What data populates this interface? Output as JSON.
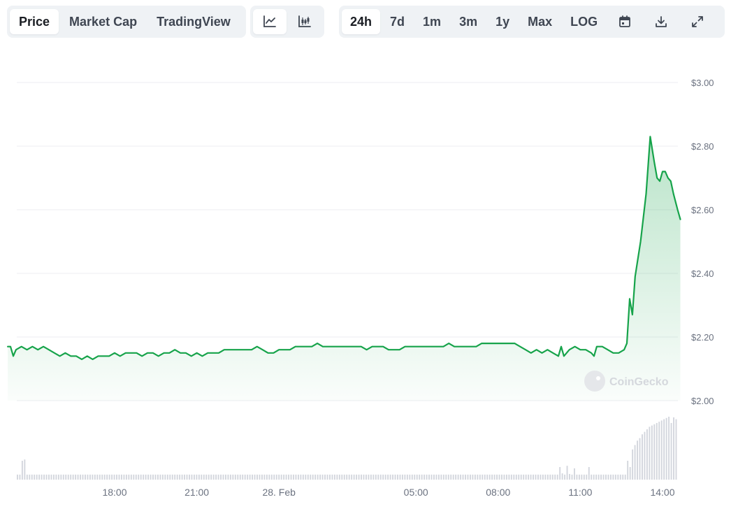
{
  "toolbar": {
    "metric_tabs": [
      {
        "label": "Price",
        "active": true
      },
      {
        "label": "Market Cap",
        "active": false
      },
      {
        "label": "TradingView",
        "active": false
      }
    ],
    "chart_type_buttons": [
      {
        "icon": "line-chart-icon",
        "active": true
      },
      {
        "icon": "candlestick-chart-icon",
        "active": false
      }
    ],
    "range_tabs": [
      {
        "label": "24h",
        "active": true
      },
      {
        "label": "7d",
        "active": false
      },
      {
        "label": "1m",
        "active": false
      },
      {
        "label": "3m",
        "active": false
      },
      {
        "label": "1y",
        "active": false
      },
      {
        "label": "Max",
        "active": false
      },
      {
        "label": "LOG",
        "active": false
      }
    ],
    "action_icons": [
      "calendar-icon",
      "download-icon",
      "expand-icon"
    ]
  },
  "watermark": {
    "text": "CoinGecko"
  },
  "colors": {
    "line": "#16a34a",
    "fill_top": "#16a34a",
    "grid": "#eceef1",
    "volume": "#d3d6dd",
    "axis_text": "#6b7280"
  },
  "chart_data": {
    "type": "line",
    "title": "",
    "xlabel": "",
    "ylabel": "",
    "ylim": [
      2.0,
      3.0
    ],
    "y_ticks": [
      "$3.00",
      "$2.80",
      "$2.60",
      "$2.40",
      "$2.20",
      "$2.00"
    ],
    "x_ticks": [
      {
        "label": "18:00",
        "hour": 18
      },
      {
        "label": "21:00",
        "hour": 21
      },
      {
        "label": "28. Feb",
        "hour": 24
      },
      {
        "label": "05:00",
        "hour": 29
      },
      {
        "label": "08:00",
        "hour": 32
      },
      {
        "label": "11:00",
        "hour": 35
      },
      {
        "label": "14:00",
        "hour": 38
      }
    ],
    "x_range_hours": [
      14.1,
      38.4
    ],
    "series": [
      {
        "values": [
          [
            14.1,
            2.17
          ],
          [
            14.2,
            2.17
          ],
          [
            14.3,
            2.14
          ],
          [
            14.4,
            2.16
          ],
          [
            14.6,
            2.17
          ],
          [
            14.8,
            2.16
          ],
          [
            15.0,
            2.17
          ],
          [
            15.2,
            2.16
          ],
          [
            15.4,
            2.17
          ],
          [
            15.6,
            2.16
          ],
          [
            15.8,
            2.15
          ],
          [
            16.0,
            2.14
          ],
          [
            16.2,
            2.15
          ],
          [
            16.4,
            2.14
          ],
          [
            16.6,
            2.14
          ],
          [
            16.8,
            2.13
          ],
          [
            17.0,
            2.14
          ],
          [
            17.2,
            2.13
          ],
          [
            17.4,
            2.14
          ],
          [
            17.6,
            2.14
          ],
          [
            17.8,
            2.14
          ],
          [
            18.0,
            2.15
          ],
          [
            18.2,
            2.14
          ],
          [
            18.4,
            2.15
          ],
          [
            18.6,
            2.15
          ],
          [
            18.8,
            2.15
          ],
          [
            19.0,
            2.14
          ],
          [
            19.2,
            2.15
          ],
          [
            19.4,
            2.15
          ],
          [
            19.6,
            2.14
          ],
          [
            19.8,
            2.15
          ],
          [
            20.0,
            2.15
          ],
          [
            20.2,
            2.16
          ],
          [
            20.4,
            2.15
          ],
          [
            20.6,
            2.15
          ],
          [
            20.8,
            2.14
          ],
          [
            21.0,
            2.15
          ],
          [
            21.2,
            2.14
          ],
          [
            21.4,
            2.15
          ],
          [
            21.6,
            2.15
          ],
          [
            21.8,
            2.15
          ],
          [
            22.0,
            2.16
          ],
          [
            22.2,
            2.16
          ],
          [
            22.4,
            2.16
          ],
          [
            22.6,
            2.16
          ],
          [
            22.8,
            2.16
          ],
          [
            23.0,
            2.16
          ],
          [
            23.2,
            2.17
          ],
          [
            23.4,
            2.16
          ],
          [
            23.6,
            2.15
          ],
          [
            23.8,
            2.15
          ],
          [
            24.0,
            2.16
          ],
          [
            24.2,
            2.16
          ],
          [
            24.4,
            2.16
          ],
          [
            24.6,
            2.17
          ],
          [
            24.8,
            2.17
          ],
          [
            25.0,
            2.17
          ],
          [
            25.2,
            2.17
          ],
          [
            25.4,
            2.18
          ],
          [
            25.6,
            2.17
          ],
          [
            25.8,
            2.17
          ],
          [
            26.0,
            2.17
          ],
          [
            26.2,
            2.17
          ],
          [
            26.4,
            2.17
          ],
          [
            26.6,
            2.17
          ],
          [
            26.8,
            2.17
          ],
          [
            27.0,
            2.17
          ],
          [
            27.2,
            2.16
          ],
          [
            27.4,
            2.17
          ],
          [
            27.6,
            2.17
          ],
          [
            27.8,
            2.17
          ],
          [
            28.0,
            2.16
          ],
          [
            28.2,
            2.16
          ],
          [
            28.4,
            2.16
          ],
          [
            28.6,
            2.17
          ],
          [
            28.8,
            2.17
          ],
          [
            29.0,
            2.17
          ],
          [
            29.2,
            2.17
          ],
          [
            29.4,
            2.17
          ],
          [
            29.6,
            2.17
          ],
          [
            29.8,
            2.17
          ],
          [
            30.0,
            2.17
          ],
          [
            30.2,
            2.18
          ],
          [
            30.4,
            2.17
          ],
          [
            30.6,
            2.17
          ],
          [
            30.8,
            2.17
          ],
          [
            31.0,
            2.17
          ],
          [
            31.2,
            2.17
          ],
          [
            31.4,
            2.18
          ],
          [
            31.6,
            2.18
          ],
          [
            31.8,
            2.18
          ],
          [
            32.0,
            2.18
          ],
          [
            32.2,
            2.18
          ],
          [
            32.4,
            2.18
          ],
          [
            32.6,
            2.18
          ],
          [
            32.8,
            2.17
          ],
          [
            33.0,
            2.16
          ],
          [
            33.2,
            2.15
          ],
          [
            33.4,
            2.16
          ],
          [
            33.6,
            2.15
          ],
          [
            33.8,
            2.16
          ],
          [
            34.0,
            2.15
          ],
          [
            34.2,
            2.14
          ],
          [
            34.3,
            2.17
          ],
          [
            34.4,
            2.14
          ],
          [
            34.6,
            2.16
          ],
          [
            34.8,
            2.17
          ],
          [
            35.0,
            2.16
          ],
          [
            35.2,
            2.16
          ],
          [
            35.4,
            2.15
          ],
          [
            35.5,
            2.14
          ],
          [
            35.6,
            2.17
          ],
          [
            35.8,
            2.17
          ],
          [
            36.0,
            2.16
          ],
          [
            36.2,
            2.15
          ],
          [
            36.4,
            2.15
          ],
          [
            36.6,
            2.16
          ],
          [
            36.7,
            2.18
          ],
          [
            36.8,
            2.32
          ],
          [
            36.9,
            2.27
          ],
          [
            37.0,
            2.39
          ],
          [
            37.2,
            2.5
          ],
          [
            37.4,
            2.65
          ],
          [
            37.55,
            2.83
          ],
          [
            37.7,
            2.75
          ],
          [
            37.8,
            2.7
          ],
          [
            37.9,
            2.69
          ],
          [
            38.0,
            2.72
          ],
          [
            38.1,
            2.72
          ],
          [
            38.2,
            2.7
          ],
          [
            38.3,
            2.69
          ],
          [
            38.4,
            2.65
          ],
          [
            38.55,
            2.6
          ],
          [
            38.65,
            2.57
          ]
        ]
      }
    ],
    "volume": {
      "values": [
        0.08,
        0.08,
        0.3,
        0.32,
        0.08,
        0.08,
        0.08,
        0.08,
        0.08,
        0.08,
        0.08,
        0.08,
        0.08,
        0.08,
        0.08,
        0.08,
        0.08,
        0.08,
        0.08,
        0.08,
        0.08,
        0.08,
        0.08,
        0.08,
        0.08,
        0.08,
        0.08,
        0.08,
        0.08,
        0.08,
        0.08,
        0.08,
        0.08,
        0.08,
        0.08,
        0.08,
        0.08,
        0.08,
        0.08,
        0.08,
        0.08,
        0.08,
        0.08,
        0.08,
        0.08,
        0.08,
        0.08,
        0.08,
        0.08,
        0.08,
        0.08,
        0.08,
        0.08,
        0.08,
        0.08,
        0.08,
        0.08,
        0.08,
        0.08,
        0.08,
        0.08,
        0.08,
        0.08,
        0.08,
        0.08,
        0.08,
        0.08,
        0.08,
        0.08,
        0.08,
        0.08,
        0.08,
        0.08,
        0.08,
        0.08,
        0.08,
        0.08,
        0.08,
        0.08,
        0.08,
        0.08,
        0.08,
        0.08,
        0.08,
        0.08,
        0.08,
        0.08,
        0.08,
        0.08,
        0.08,
        0.08,
        0.08,
        0.08,
        0.08,
        0.08,
        0.08,
        0.08,
        0.08,
        0.08,
        0.08,
        0.08,
        0.08,
        0.08,
        0.08,
        0.08,
        0.08,
        0.08,
        0.08,
        0.08,
        0.08,
        0.08,
        0.08,
        0.08,
        0.08,
        0.08,
        0.08,
        0.08,
        0.08,
        0.08,
        0.08,
        0.08,
        0.08,
        0.08,
        0.08,
        0.08,
        0.08,
        0.08,
        0.08,
        0.08,
        0.08,
        0.08,
        0.08,
        0.08,
        0.08,
        0.08,
        0.08,
        0.08,
        0.08,
        0.08,
        0.08,
        0.08,
        0.08,
        0.08,
        0.08,
        0.08,
        0.08,
        0.08,
        0.08,
        0.08,
        0.08,
        0.08,
        0.08,
        0.08,
        0.08,
        0.08,
        0.08,
        0.08,
        0.08,
        0.08,
        0.08,
        0.08,
        0.08,
        0.08,
        0.08,
        0.08,
        0.08,
        0.08,
        0.08,
        0.08,
        0.08,
        0.08,
        0.08,
        0.08,
        0.08,
        0.08,
        0.08,
        0.08,
        0.08,
        0.08,
        0.08,
        0.08,
        0.08,
        0.08,
        0.08,
        0.08,
        0.08,
        0.08,
        0.08,
        0.08,
        0.08,
        0.08,
        0.08,
        0.08,
        0.08,
        0.08,
        0.08,
        0.08,
        0.08,
        0.08,
        0.08,
        0.08,
        0.08,
        0.08,
        0.08,
        0.08,
        0.08,
        0.08,
        0.08,
        0.08,
        0.08,
        0.08,
        0.08,
        0.08,
        0.08,
        0.08,
        0.08,
        0.08,
        0.08,
        0.08,
        0.08,
        0.08,
        0.08,
        0.08,
        0.08,
        0.2,
        0.1,
        0.08,
        0.22,
        0.09,
        0.08,
        0.18,
        0.08,
        0.08,
        0.08,
        0.08,
        0.08,
        0.2,
        0.08,
        0.08,
        0.08,
        0.08,
        0.08,
        0.08,
        0.08,
        0.08,
        0.08,
        0.08,
        0.08,
        0.08,
        0.08,
        0.08,
        0.08,
        0.3,
        0.2,
        0.48,
        0.55,
        0.62,
        0.66,
        0.72,
        0.76,
        0.8,
        0.84,
        0.86,
        0.88,
        0.9,
        0.92,
        0.94,
        0.96,
        0.98,
        1.0,
        0.9,
        0.99,
        0.96
      ]
    }
  }
}
